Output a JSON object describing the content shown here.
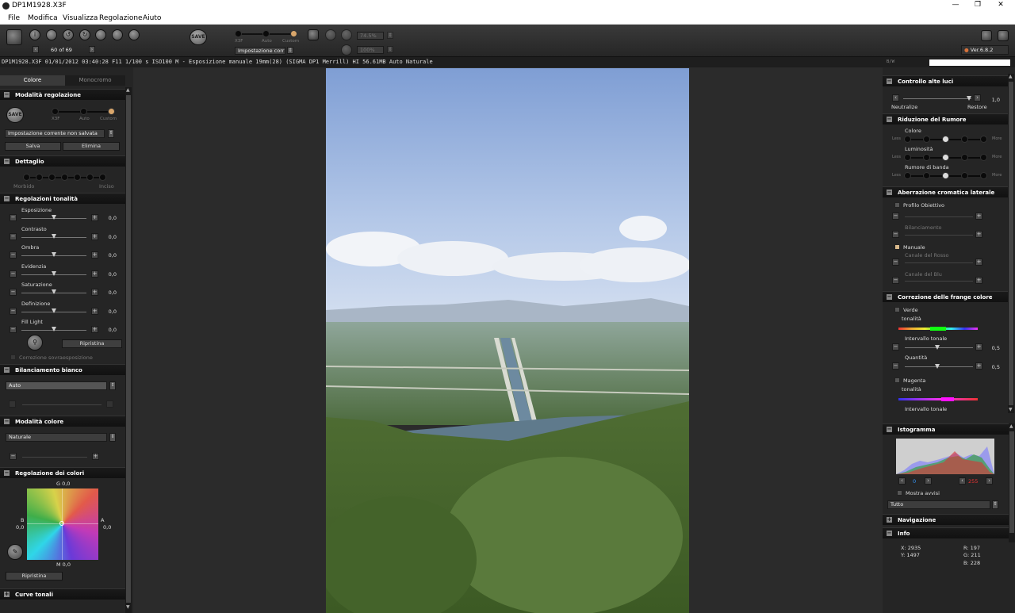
{
  "titlebar": {
    "title": "DP1M1928.X3F",
    "minimize": "—",
    "maximize": "❐",
    "close": "✕"
  },
  "menu": [
    "File",
    "Modifica",
    "Visualizza",
    "Regolazione",
    "Aiuto"
  ],
  "toolbar": {
    "counter": "60 of 69",
    "save": "SAVE",
    "mode_labels": [
      "X3F",
      "Auto",
      "Custom"
    ],
    "setting_combo": "Impostazione corr",
    "zoom1": "74.5%",
    "zoom2": "100%",
    "version": "Ver.6.8.2"
  },
  "infobar": {
    "text": "DP1M1928.X3F 01/01/2012 03:40:28 F11 1/100 s ISO100 M - Esposizione manuale 19mm(28) (SIGMA DP1 Merrill) HI 56.61MB Auto Naturale",
    "bw": "B/W"
  },
  "left": {
    "tabs": [
      "Colore",
      "Monocromo"
    ],
    "sections": {
      "modalita": "Modalità regolazione",
      "dettaglio": "Dettaglio",
      "tonalita": "Regolazioni tonalità",
      "bilanciamento": "Bilanciamento bianco",
      "modalita_colore": "Modalità colore",
      "colori": "Regolazione dei colori",
      "curve": "Curve tonali"
    },
    "save": "SAVE",
    "mode_labels": [
      "X3F",
      "Auto",
      "Custom"
    ],
    "setting_select": "Impostazione corrente non salvata",
    "salva": "Salva",
    "elimina": "Elimina",
    "detail_labels": [
      "Morbido",
      "Inciso"
    ],
    "sliders": [
      {
        "label": "Esposizione",
        "value": "0,0"
      },
      {
        "label": "Contrasto",
        "value": "0,0"
      },
      {
        "label": "Ombra",
        "value": "0,0"
      },
      {
        "label": "Evidenzia",
        "value": "0,0"
      },
      {
        "label": "Saturazione",
        "value": "0,0"
      },
      {
        "label": "Definizione",
        "value": "0,0"
      },
      {
        "label": "Fill Light",
        "value": "0,0"
      }
    ],
    "ripristina": "Ripristina",
    "correzione": "Correzione sovraesposizione",
    "wb_select": "Auto",
    "color_mode_select": "Naturale",
    "color_grid": {
      "top": "G 0,0",
      "left": "B",
      "left_val": "0,0",
      "right": "A",
      "right_val": "0,0",
      "bottom": "M 0,0"
    },
    "ripristina2": "Ripristina"
  },
  "right": {
    "sections": {
      "luci": "Controllo alte luci",
      "rumore": "Riduzione del Rumore",
      "aberrazione": "Aberrazione cromatica laterale",
      "frange": "Correzione delle frange colore",
      "istogramma": "Istogramma",
      "navigazione": "Navigazione",
      "info": "Info"
    },
    "luci": {
      "neutralize": "Neutralize",
      "restore": "Restore",
      "value": "1,0"
    },
    "rumore": {
      "colore": "Colore",
      "luminosita": "Luminosità",
      "rumore_banda": "Rumore di banda",
      "less": "Less",
      "more": "More"
    },
    "aberrazione": {
      "profilo": "Profilo Obiettivo",
      "bilanciamento": "Bilanciamento",
      "manuale": "Manuale",
      "canale_rosso": "Canale del Rosso",
      "canale_blu": "Canale del Blu"
    },
    "frange": {
      "verde": "Verde",
      "tonalita": "tonalità",
      "intervallo": "Intervallo tonale",
      "intervallo_val": "0,5",
      "quantita": "Quantità",
      "quantita_val": "0,5",
      "magenta": "Magenta",
      "tonalita2": "tonalità",
      "intervallo2": "Intervallo tonale"
    },
    "istogramma": {
      "left_val": "0",
      "right_val": "255",
      "mostra": "Mostra avvisi",
      "select": "Tutto"
    },
    "info": {
      "x": "X:  2935",
      "y": "Y:  1497",
      "r": "R:   197",
      "g": "G:   211",
      "b": "B:   228"
    }
  },
  "colors": {
    "accent": "#d9a66b",
    "panel": "#252525",
    "header": "#111111"
  }
}
